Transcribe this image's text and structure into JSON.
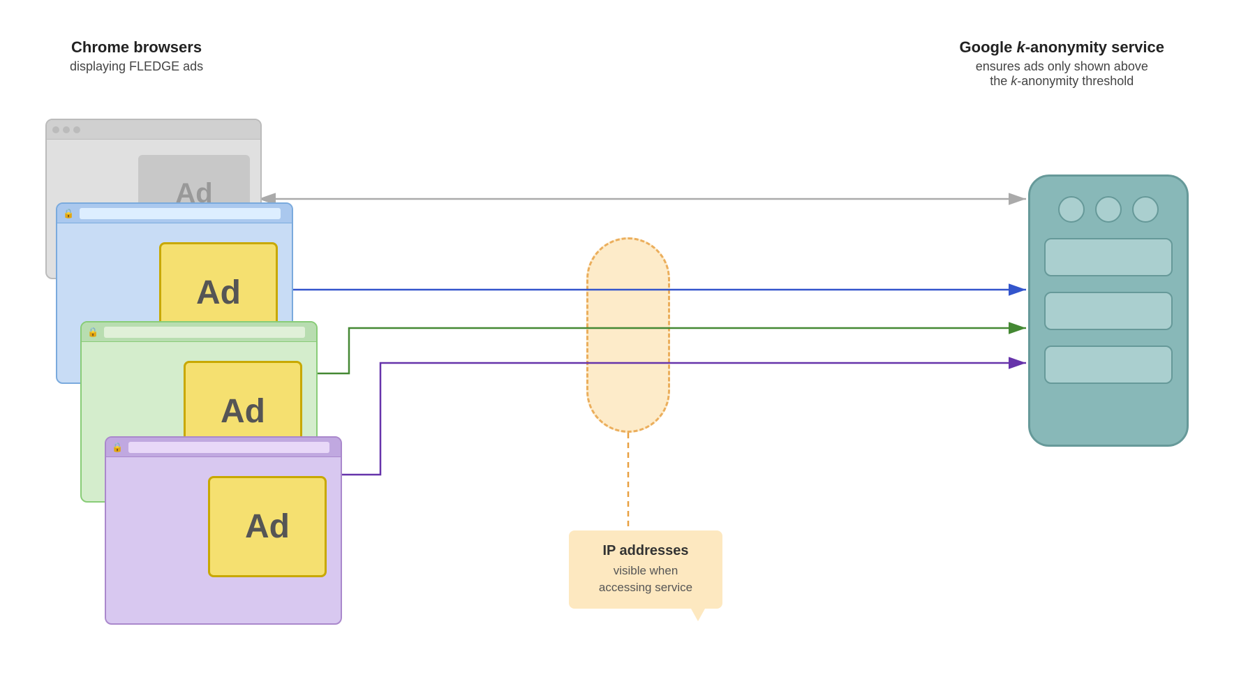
{
  "header": {
    "left_title": "Chrome browsers",
    "left_subtitle": "displaying FLEDGE ads",
    "right_title_prefix": "Google ",
    "right_title_italic": "k",
    "right_title_suffix": "-anonymity service",
    "right_subtitle_line1": "ensures ads only shown above",
    "right_subtitle_line2_prefix": "the ",
    "right_subtitle_line2_italic": "k",
    "right_subtitle_line2_suffix": "-anonymity threshold"
  },
  "browsers": {
    "gray": {
      "ad_label": "Ad"
    },
    "blue": {
      "ad_label": "Ad"
    },
    "green": {
      "ad_label": "Ad"
    },
    "purple": {
      "ad_label": "Ad"
    }
  },
  "ip_label": {
    "title": "IP addresses",
    "subtitle": "visible when\naccessing service"
  },
  "colors": {
    "blue_arrow": "#3355cc",
    "green_arrow": "#448833",
    "purple_arrow": "#6633aa",
    "gray_arrow": "#999999"
  }
}
